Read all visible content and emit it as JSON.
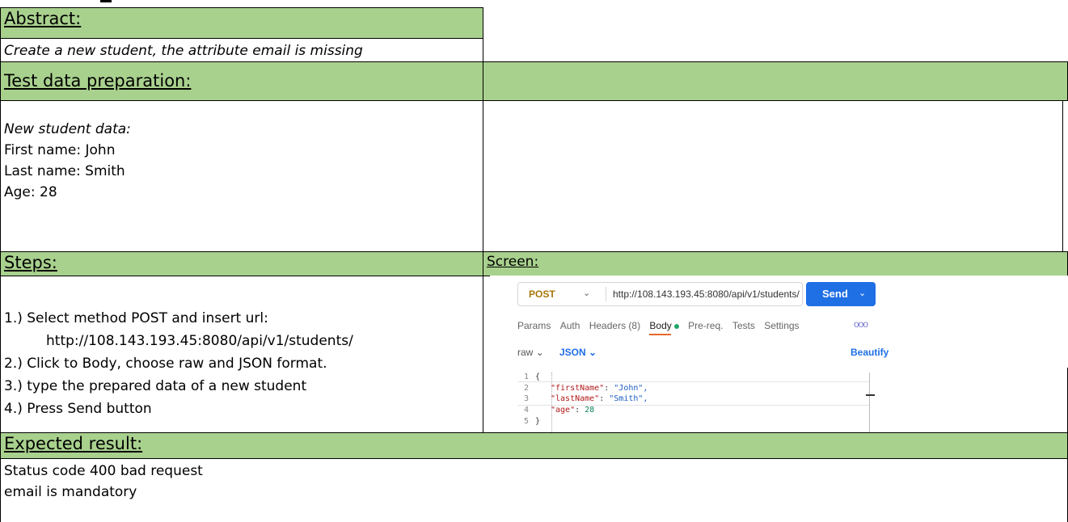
{
  "abstract": {
    "header": "Abstract:",
    "text": "Create a new student, the attribute email is missing"
  },
  "test_data": {
    "header": "Test data preparation:",
    "intro": "New student data:",
    "lines": [
      "First name: John",
      "Last name: Smith",
      "Age: 28"
    ]
  },
  "steps": {
    "header": "Steps:",
    "items": [
      "1.) Select method POST and insert url:",
      "http://108.143.193.45:8080/api/v1/students/",
      "2.) Click to Body, choose raw and JSON format.",
      "3.) type the prepared data of a new student",
      "4.) Press Send button"
    ]
  },
  "screen": {
    "header": "Screen:",
    "method": "POST",
    "url": "http://108.143.193.45:8080/api/v1/students/",
    "send_label": "Send",
    "tabs": [
      "Params",
      "Auth",
      "Headers (8)",
      "Body",
      "Pre-req.",
      "Tests",
      "Settings"
    ],
    "active_tab": "Body",
    "more": "ooo",
    "body_mode": "raw",
    "body_format": "JSON",
    "beautify": "Beautify",
    "code_lines": [
      {
        "n": "1",
        "text": "{"
      },
      {
        "n": "2",
        "key": "\"firstName\"",
        "val": "\"John\","
      },
      {
        "n": "3",
        "key": "\"lastName\"",
        "val": "\"Smith\","
      },
      {
        "n": "4",
        "key": "\"age\"",
        "val": "28"
      },
      {
        "n": "5",
        "text": "}"
      }
    ],
    "accent_colors": {
      "send": "#1f6fe5",
      "active_tab": "#e8692a",
      "method": "#a6760a"
    }
  },
  "expected": {
    "header": "Expected result:",
    "lines": [
      "Status code 400 bad request",
      "email is mandatory"
    ]
  },
  "header_color": "#a9d18e"
}
